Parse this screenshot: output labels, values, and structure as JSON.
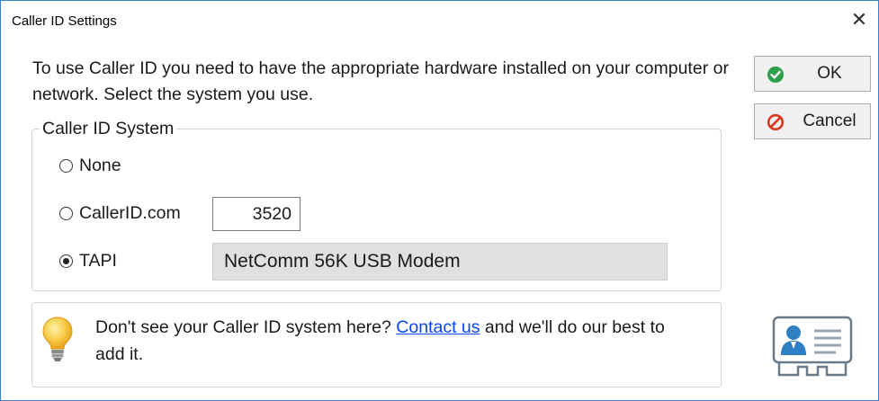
{
  "window": {
    "title": "Caller ID Settings",
    "close_glyph": "✕"
  },
  "intro_text": "To use Caller ID you need to have the appropriate hardware installed on your computer or network.  Select the system you use.",
  "buttons": {
    "ok": {
      "label": "OK",
      "icon": "check-circle-icon",
      "icon_color": "#2e9e4a"
    },
    "cancel": {
      "label": "Cancel",
      "icon": "prohibited-icon",
      "icon_color": "#d9361c"
    }
  },
  "system_group": {
    "legend": "Caller ID System",
    "options": [
      {
        "label": "None",
        "selected": false
      },
      {
        "label": "CallerID.com",
        "selected": false,
        "port_value": "3520"
      },
      {
        "label": "TAPI",
        "selected": true,
        "device": "NetComm 56K USB Modem"
      }
    ]
  },
  "tip": {
    "icon": "lightbulb-icon",
    "text_before": "Don't see your Caller ID system here?  ",
    "link_text": "Contact us",
    "text_after": " and we'll do our best to add it."
  },
  "decor": {
    "card_icon": "contact-card-icon"
  },
  "colors": {
    "link": "#0645ff",
    "border": "#d4d4d4",
    "window_border": "#3b7fd1"
  }
}
